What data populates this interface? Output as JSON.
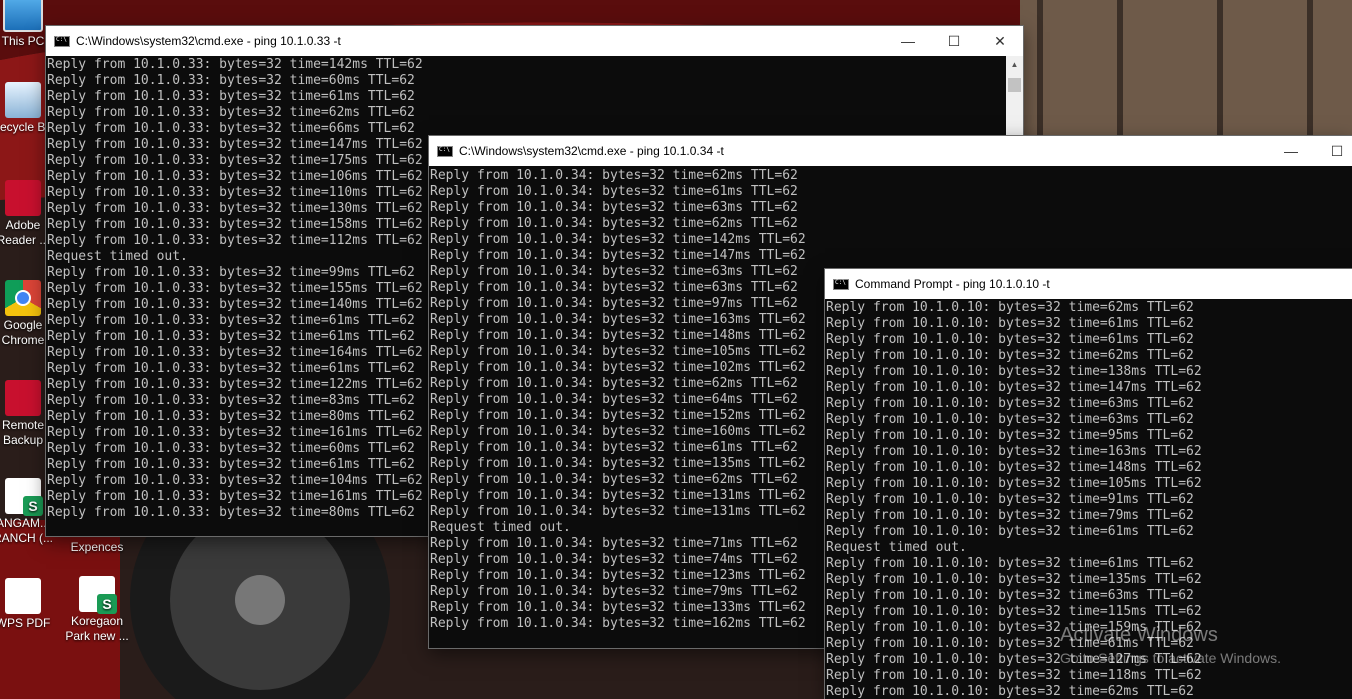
{
  "desktop": {
    "icons": [
      {
        "label": "This PC"
      },
      {
        "label": "Recycle Bin"
      },
      {
        "label": "Adobe Reader ..."
      },
      {
        "label": "Google Chrome"
      },
      {
        "label": "Remote Backup"
      },
      {
        "label": "ANGAM... RANCH (..."
      },
      {
        "label": "WPS PDF"
      },
      {
        "label": "Koregaon Park new ..."
      },
      {
        "label": "Expences"
      }
    ]
  },
  "windows": {
    "ping33": {
      "title": "C:\\Windows\\system32\\cmd.exe - ping  10.1.0.33 -t",
      "controls": {
        "minimize": "—",
        "maximize": "☐",
        "close": "✕"
      },
      "lines": [
        "Reply from 10.1.0.33: bytes=32 time=142ms TTL=62",
        "Reply from 10.1.0.33: bytes=32 time=60ms TTL=62",
        "Reply from 10.1.0.33: bytes=32 time=61ms TTL=62",
        "Reply from 10.1.0.33: bytes=32 time=62ms TTL=62",
        "Reply from 10.1.0.33: bytes=32 time=66ms TTL=62",
        "Reply from 10.1.0.33: bytes=32 time=147ms TTL=62",
        "Reply from 10.1.0.33: bytes=32 time=175ms TTL=62",
        "Reply from 10.1.0.33: bytes=32 time=106ms TTL=62",
        "Reply from 10.1.0.33: bytes=32 time=110ms TTL=62",
        "Reply from 10.1.0.33: bytes=32 time=130ms TTL=62",
        "Reply from 10.1.0.33: bytes=32 time=158ms TTL=62",
        "Reply from 10.1.0.33: bytes=32 time=112ms TTL=62",
        "Request timed out.",
        "Reply from 10.1.0.33: bytes=32 time=99ms TTL=62",
        "Reply from 10.1.0.33: bytes=32 time=155ms TTL=62",
        "Reply from 10.1.0.33: bytes=32 time=140ms TTL=62",
        "Reply from 10.1.0.33: bytes=32 time=61ms TTL=62",
        "Reply from 10.1.0.33: bytes=32 time=61ms TTL=62",
        "Reply from 10.1.0.33: bytes=32 time=164ms TTL=62",
        "Reply from 10.1.0.33: bytes=32 time=61ms TTL=62",
        "Reply from 10.1.0.33: bytes=32 time=122ms TTL=62",
        "Reply from 10.1.0.33: bytes=32 time=83ms TTL=62",
        "Reply from 10.1.0.33: bytes=32 time=80ms TTL=62",
        "Reply from 10.1.0.33: bytes=32 time=161ms TTL=62",
        "Reply from 10.1.0.33: bytes=32 time=60ms TTL=62",
        "Reply from 10.1.0.33: bytes=32 time=61ms TTL=62",
        "Reply from 10.1.0.33: bytes=32 time=104ms TTL=62",
        "Reply from 10.1.0.33: bytes=32 time=161ms TTL=62",
        "Reply from 10.1.0.33: bytes=32 time=80ms TTL=62"
      ]
    },
    "ping34": {
      "title": "C:\\Windows\\system32\\cmd.exe - ping  10.1.0.34 -t",
      "controls": {
        "minimize": "—",
        "maximize": "☐"
      },
      "lines": [
        "Reply from 10.1.0.34: bytes=32 time=62ms TTL=62",
        "Reply from 10.1.0.34: bytes=32 time=61ms TTL=62",
        "Reply from 10.1.0.34: bytes=32 time=63ms TTL=62",
        "Reply from 10.1.0.34: bytes=32 time=62ms TTL=62",
        "Reply from 10.1.0.34: bytes=32 time=142ms TTL=62",
        "Reply from 10.1.0.34: bytes=32 time=147ms TTL=62",
        "Reply from 10.1.0.34: bytes=32 time=63ms TTL=62",
        "Reply from 10.1.0.34: bytes=32 time=63ms TTL=62",
        "Reply from 10.1.0.34: bytes=32 time=97ms TTL=62",
        "Reply from 10.1.0.34: bytes=32 time=163ms TTL=62",
        "Reply from 10.1.0.34: bytes=32 time=148ms TTL=62",
        "Reply from 10.1.0.34: bytes=32 time=105ms TTL=62",
        "Reply from 10.1.0.34: bytes=32 time=102ms TTL=62",
        "Reply from 10.1.0.34: bytes=32 time=62ms TTL=62",
        "Reply from 10.1.0.34: bytes=32 time=64ms TTL=62",
        "Reply from 10.1.0.34: bytes=32 time=152ms TTL=62",
        "Reply from 10.1.0.34: bytes=32 time=160ms TTL=62",
        "Reply from 10.1.0.34: bytes=32 time=61ms TTL=62",
        "Reply from 10.1.0.34: bytes=32 time=135ms TTL=62",
        "Reply from 10.1.0.34: bytes=32 time=62ms TTL=62",
        "Reply from 10.1.0.34: bytes=32 time=131ms TTL=62",
        "Reply from 10.1.0.34: bytes=32 time=131ms TTL=62",
        "Request timed out.",
        "Reply from 10.1.0.34: bytes=32 time=71ms TTL=62",
        "Reply from 10.1.0.34: bytes=32 time=74ms TTL=62",
        "Reply from 10.1.0.34: bytes=32 time=123ms TTL=62",
        "Reply from 10.1.0.34: bytes=32 time=79ms TTL=62",
        "Reply from 10.1.0.34: bytes=32 time=133ms TTL=62",
        "Reply from 10.1.0.34: bytes=32 time=162ms TTL=62"
      ]
    },
    "ping10": {
      "title": "Command Prompt - ping  10.1.0.10 -t",
      "lines": [
        "Reply from 10.1.0.10: bytes=32 time=62ms TTL=62",
        "Reply from 10.1.0.10: bytes=32 time=61ms TTL=62",
        "Reply from 10.1.0.10: bytes=32 time=61ms TTL=62",
        "Reply from 10.1.0.10: bytes=32 time=62ms TTL=62",
        "Reply from 10.1.0.10: bytes=32 time=138ms TTL=62",
        "Reply from 10.1.0.10: bytes=32 time=147ms TTL=62",
        "Reply from 10.1.0.10: bytes=32 time=63ms TTL=62",
        "Reply from 10.1.0.10: bytes=32 time=63ms TTL=62",
        "Reply from 10.1.0.10: bytes=32 time=95ms TTL=62",
        "Reply from 10.1.0.10: bytes=32 time=163ms TTL=62",
        "Reply from 10.1.0.10: bytes=32 time=148ms TTL=62",
        "Reply from 10.1.0.10: bytes=32 time=105ms TTL=62",
        "Reply from 10.1.0.10: bytes=32 time=91ms TTL=62",
        "Reply from 10.1.0.10: bytes=32 time=79ms TTL=62",
        "Reply from 10.1.0.10: bytes=32 time=61ms TTL=62",
        "Request timed out.",
        "Reply from 10.1.0.10: bytes=32 time=61ms TTL=62",
        "Reply from 10.1.0.10: bytes=32 time=135ms TTL=62",
        "Reply from 10.1.0.10: bytes=32 time=63ms TTL=62",
        "Reply from 10.1.0.10: bytes=32 time=115ms TTL=62",
        "Reply from 10.1.0.10: bytes=32 time=159ms TTL=62",
        "Reply from 10.1.0.10: bytes=32 time=61ms TTL=62",
        "Reply from 10.1.0.10: bytes=32 time=127ms TTL=62",
        "Reply from 10.1.0.10: bytes=32 time=118ms TTL=62",
        "Reply from 10.1.0.10: bytes=32 time=62ms TTL=62"
      ]
    }
  },
  "watermark": {
    "title": "Activate Windows",
    "subtitle": "Go to Settings to activate Windows."
  }
}
